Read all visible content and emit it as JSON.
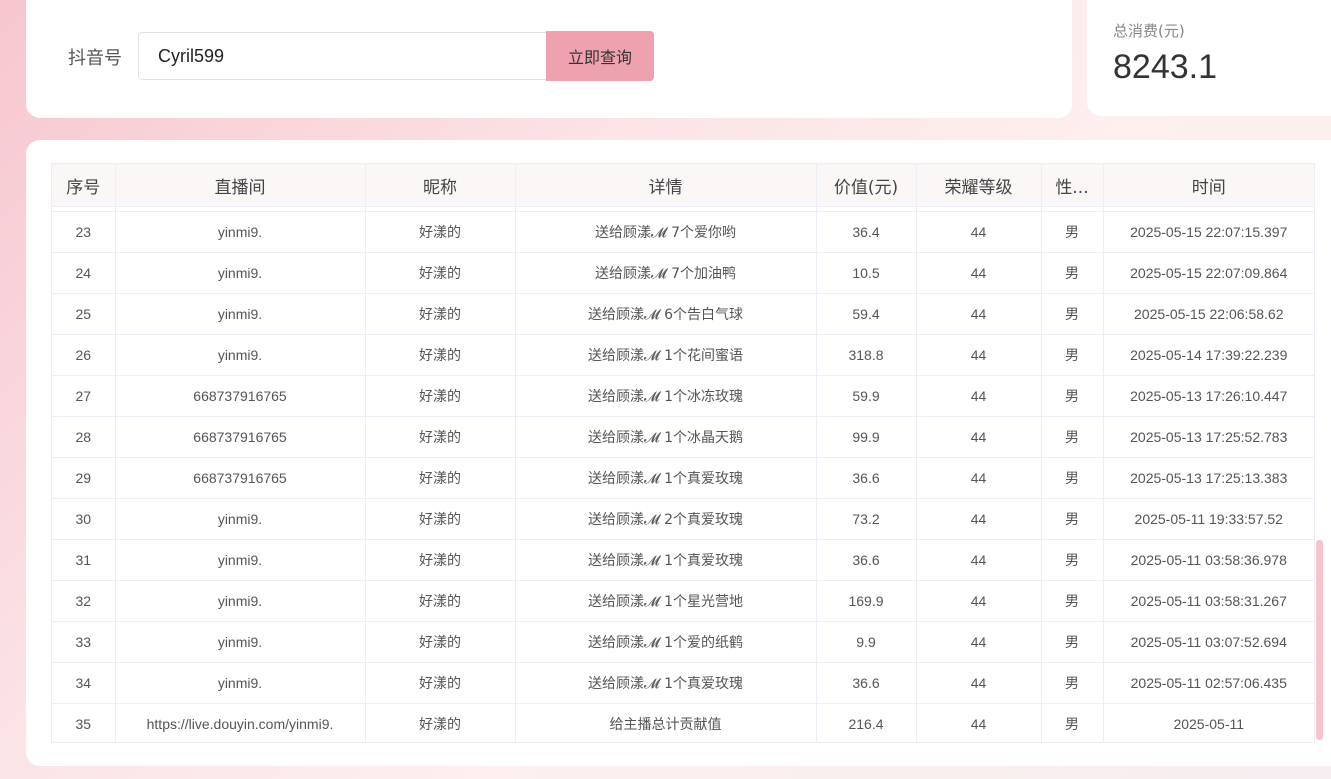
{
  "search": {
    "label": "抖音号",
    "value": "Cyril599",
    "button": "立即查询"
  },
  "summary": {
    "label": "总消费(元)",
    "value": "8243.1"
  },
  "table": {
    "columns": [
      "序号",
      "直播间",
      "昵称",
      "详情",
      "价值(元)",
      "荣耀等级",
      "性...",
      "时间"
    ],
    "rows": [
      [
        "23",
        "yinmi9.",
        "好漾的",
        "送给顾漾𝓜 7个爱你哟",
        "36.4",
        "44",
        "男",
        "2025-05-15 22:07:15.397"
      ],
      [
        "24",
        "yinmi9.",
        "好漾的",
        "送给顾漾𝓜 7个加油鸭",
        "10.5",
        "44",
        "男",
        "2025-05-15 22:07:09.864"
      ],
      [
        "25",
        "yinmi9.",
        "好漾的",
        "送给顾漾𝓜 6个告白气球",
        "59.4",
        "44",
        "男",
        "2025-05-15 22:06:58.62"
      ],
      [
        "26",
        "yinmi9.",
        "好漾的",
        "送给顾漾𝓜 1个花间蜜语",
        "318.8",
        "44",
        "男",
        "2025-05-14 17:39:22.239"
      ],
      [
        "27",
        "668737916765",
        "好漾的",
        "送给顾漾𝓜 1个冰冻玫瑰",
        "59.9",
        "44",
        "男",
        "2025-05-13 17:26:10.447"
      ],
      [
        "28",
        "668737916765",
        "好漾的",
        "送给顾漾𝓜 1个冰晶天鹅",
        "99.9",
        "44",
        "男",
        "2025-05-13 17:25:52.783"
      ],
      [
        "29",
        "668737916765",
        "好漾的",
        "送给顾漾𝓜 1个真爱玫瑰",
        "36.6",
        "44",
        "男",
        "2025-05-13 17:25:13.383"
      ],
      [
        "30",
        "yinmi9.",
        "好漾的",
        "送给顾漾𝓜 2个真爱玫瑰",
        "73.2",
        "44",
        "男",
        "2025-05-11 19:33:57.52"
      ],
      [
        "31",
        "yinmi9.",
        "好漾的",
        "送给顾漾𝓜 1个真爱玫瑰",
        "36.6",
        "44",
        "男",
        "2025-05-11 03:58:36.978"
      ],
      [
        "32",
        "yinmi9.",
        "好漾的",
        "送给顾漾𝓜 1个星光营地",
        "169.9",
        "44",
        "男",
        "2025-05-11 03:58:31.267"
      ],
      [
        "33",
        "yinmi9.",
        "好漾的",
        "送给顾漾𝓜 1个爱的纸鹤",
        "9.9",
        "44",
        "男",
        "2025-05-11 03:07:52.694"
      ],
      [
        "34",
        "yinmi9.",
        "好漾的",
        "送给顾漾𝓜 1个真爱玫瑰",
        "36.6",
        "44",
        "男",
        "2025-05-11 02:57:06.435"
      ],
      [
        "35",
        "https://live.douyin.com/yinmi9.",
        "好漾的",
        "给主播总计贡献值",
        "216.4",
        "44",
        "男",
        "2025-05-11"
      ]
    ]
  },
  "colors": {
    "accent": "#eea2b0",
    "link": "#d99aaa"
  }
}
